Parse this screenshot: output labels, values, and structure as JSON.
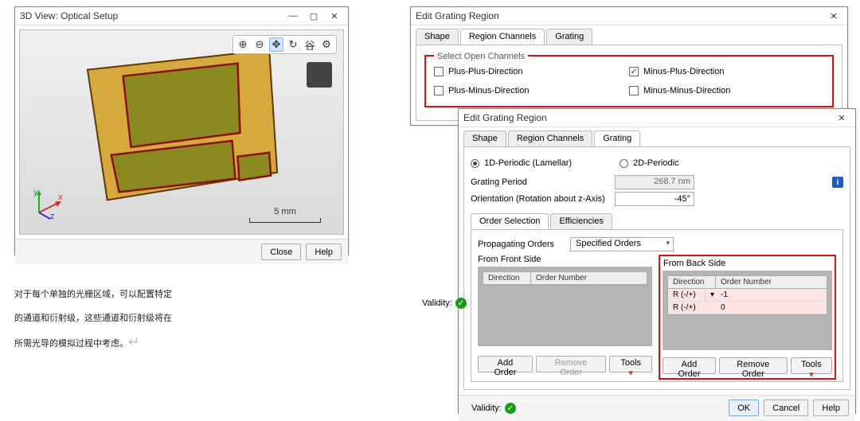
{
  "viewer": {
    "title": "3D View: Optical Setup",
    "toolbar": [
      "zoom-in",
      "zoom-out",
      "pan",
      "rotate",
      "reset",
      "settings"
    ],
    "toolbar_glyphs": [
      "⊕",
      "⊖",
      "✥",
      "↻",
      "⾕",
      "⚙"
    ],
    "scalebar_label": "5 mm",
    "close_label": "Close",
    "help_label": "Help"
  },
  "dialog1": {
    "title": "Edit Grating Region",
    "tabs": [
      "Shape",
      "Region Channels",
      "Grating"
    ],
    "active_tab": 1,
    "group_label": "Select Open Channels",
    "channels": [
      {
        "label": "Plus-Plus-Direction",
        "checked": false
      },
      {
        "label": "Plus-Minus-Direction",
        "checked": false
      },
      {
        "label": "Minus-Plus-Direction",
        "checked": true
      },
      {
        "label": "Minus-Minus-Direction",
        "checked": false
      }
    ],
    "validity_label": "Validity:"
  },
  "dialog2": {
    "title": "Edit Grating Region",
    "tabs": [
      "Shape",
      "Region Channels",
      "Grating"
    ],
    "active_tab": 2,
    "periodic": {
      "opt1": "1D-Periodic (Lamellar)",
      "opt2": "2D-Periodic",
      "selected": 0
    },
    "grating_period_label": "Grating Period",
    "grating_period_value": "268.7 nm",
    "orientation_label": "Orientation (Rotation about z-Axis)",
    "orientation_value": "-45°",
    "subtabs": [
      "Order Selection",
      "Efficiencies"
    ],
    "prop_orders_label": "Propagating Orders",
    "prop_orders_value": "Specified Orders",
    "front_label": "From Front Side",
    "back_label": "From Back Side",
    "cols": [
      "Direction",
      "Order Number"
    ],
    "back_rows": [
      {
        "dir": "R (-/+)",
        "num": "-1"
      },
      {
        "dir": "R (-/+)",
        "num": "0"
      }
    ],
    "add_order": "Add Order",
    "remove_order": "Remove Order",
    "tools": "Tools",
    "validity_label": "Validity:",
    "ok": "OK",
    "cancel": "Cancel",
    "help": "Help"
  },
  "description": {
    "line1": "对于每个单独的光栅区域，可以配置特定",
    "line2": "的通道和衍射级，这些通道和衍射级将在",
    "line3": "所需光导的模拟过程中考虑。",
    "return_glyph": "↵"
  }
}
